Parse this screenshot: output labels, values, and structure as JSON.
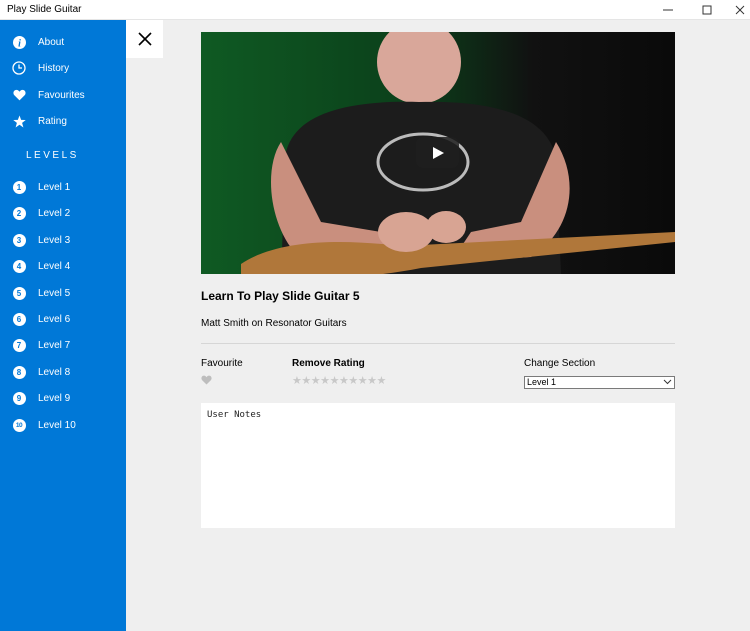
{
  "window": {
    "title": "Play Slide Guitar",
    "minimize": "—",
    "maximize": "☐",
    "close": "✕"
  },
  "sidebar": {
    "items": [
      {
        "label": "About",
        "icon": "info-icon"
      },
      {
        "label": "History",
        "icon": "clock-icon"
      },
      {
        "label": "Favourites",
        "icon": "heart-icon"
      },
      {
        "label": "Rating",
        "icon": "star-icon"
      }
    ],
    "levels_heading": "LEVELS",
    "levels": [
      {
        "num": "1",
        "label": "Level 1"
      },
      {
        "num": "2",
        "label": "Level 2"
      },
      {
        "num": "3",
        "label": "Level 3"
      },
      {
        "num": "4",
        "label": "Level 4"
      },
      {
        "num": "5",
        "label": "Level 5"
      },
      {
        "num": "6",
        "label": "Level 6"
      },
      {
        "num": "7",
        "label": "Level 7"
      },
      {
        "num": "8",
        "label": "Level 8"
      },
      {
        "num": "9",
        "label": "Level 9"
      },
      {
        "num": "10",
        "label": "Level 10"
      }
    ],
    "accent": "#0078d7"
  },
  "video": {
    "title": "Learn To Play Slide Guitar 5",
    "subtitle": "Matt Smith on Resonator Guitars",
    "play_icon": "play-icon"
  },
  "details": {
    "favourite_label": "Favourite",
    "remove_rating_label": "Remove Rating",
    "rating_stars": 10,
    "rating_value": 0,
    "change_section_label": "Change Section",
    "section_selected": "Level 1"
  },
  "notes": {
    "value": "User Notes"
  }
}
